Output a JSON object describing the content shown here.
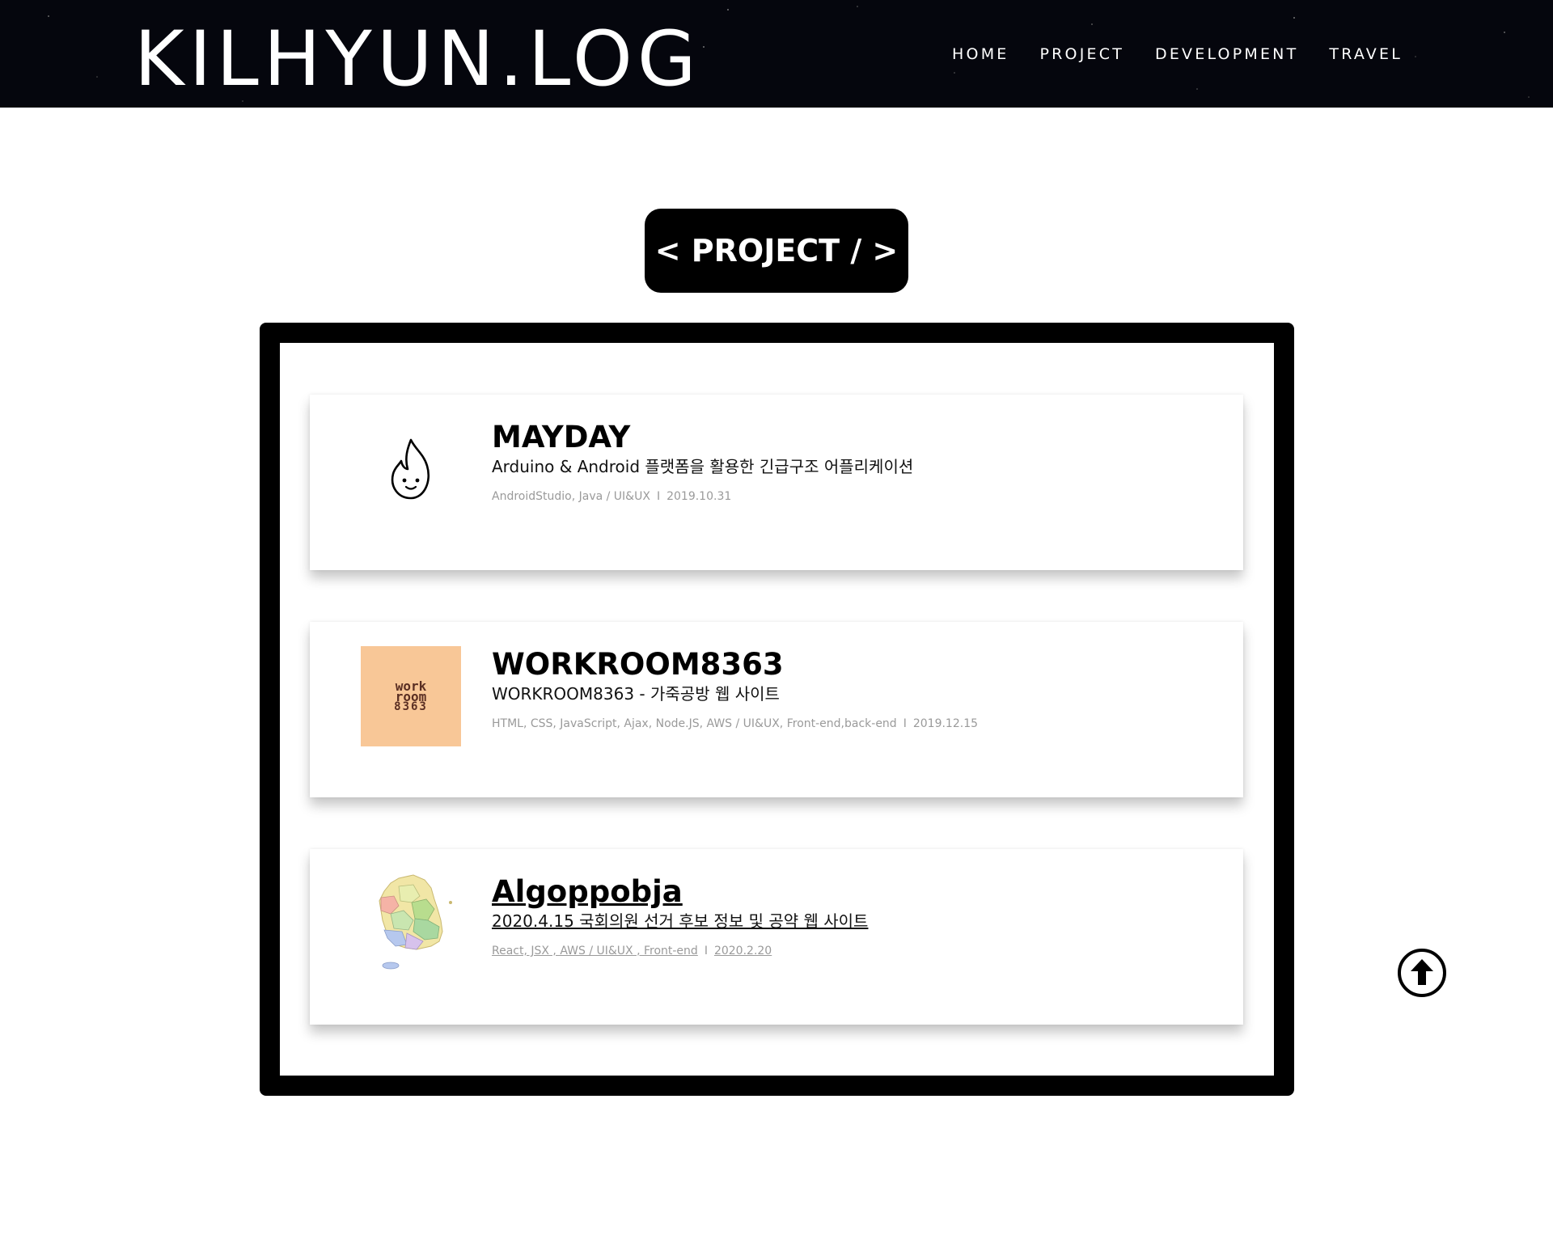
{
  "header": {
    "brand": "KILHYUN.LOG",
    "nav": [
      "HOME",
      "PROJECT",
      "DEVELOPMENT",
      "TRAVEL"
    ]
  },
  "section": {
    "title": "< PROJECT / >"
  },
  "projects": [
    {
      "icon": "flame-face-icon",
      "title": "MAYDAY",
      "description": "Arduino & Android 플랫폼을 활용한 긴급구조 어플리케이션",
      "tech": "AndroidStudio, Java / UI&UX",
      "separator": "I",
      "date": "2019.10.31"
    },
    {
      "icon": "workroom-logo",
      "logo_text": [
        "work",
        "room",
        "8363"
      ],
      "title": "WORKROOM8363",
      "description": "WORKROOM8363 - 가죽공방 웹 사이트",
      "tech": "HTML, CSS, JavaScript, Ajax, Node.JS, AWS / UI&UX, Front-end,back-end",
      "separator": "I",
      "date": "2019.12.15"
    },
    {
      "icon": "korea-map-icon",
      "title": "Algoppobja",
      "description": "2020.4.15 국회의원 선거 후보 정보 및 공약 웹 사이트",
      "tech": "React, JSX , AWS / UI&UX , Front-end",
      "separator": "I",
      "date": "2020.2.20"
    }
  ],
  "colors": {
    "header_bg": "#05060d",
    "accent": "#000000",
    "workroom_bg": "#f8c797",
    "meta_text": "#9a9a9a"
  },
  "scroll_top": {
    "icon": "arrow-up-circle-icon"
  }
}
